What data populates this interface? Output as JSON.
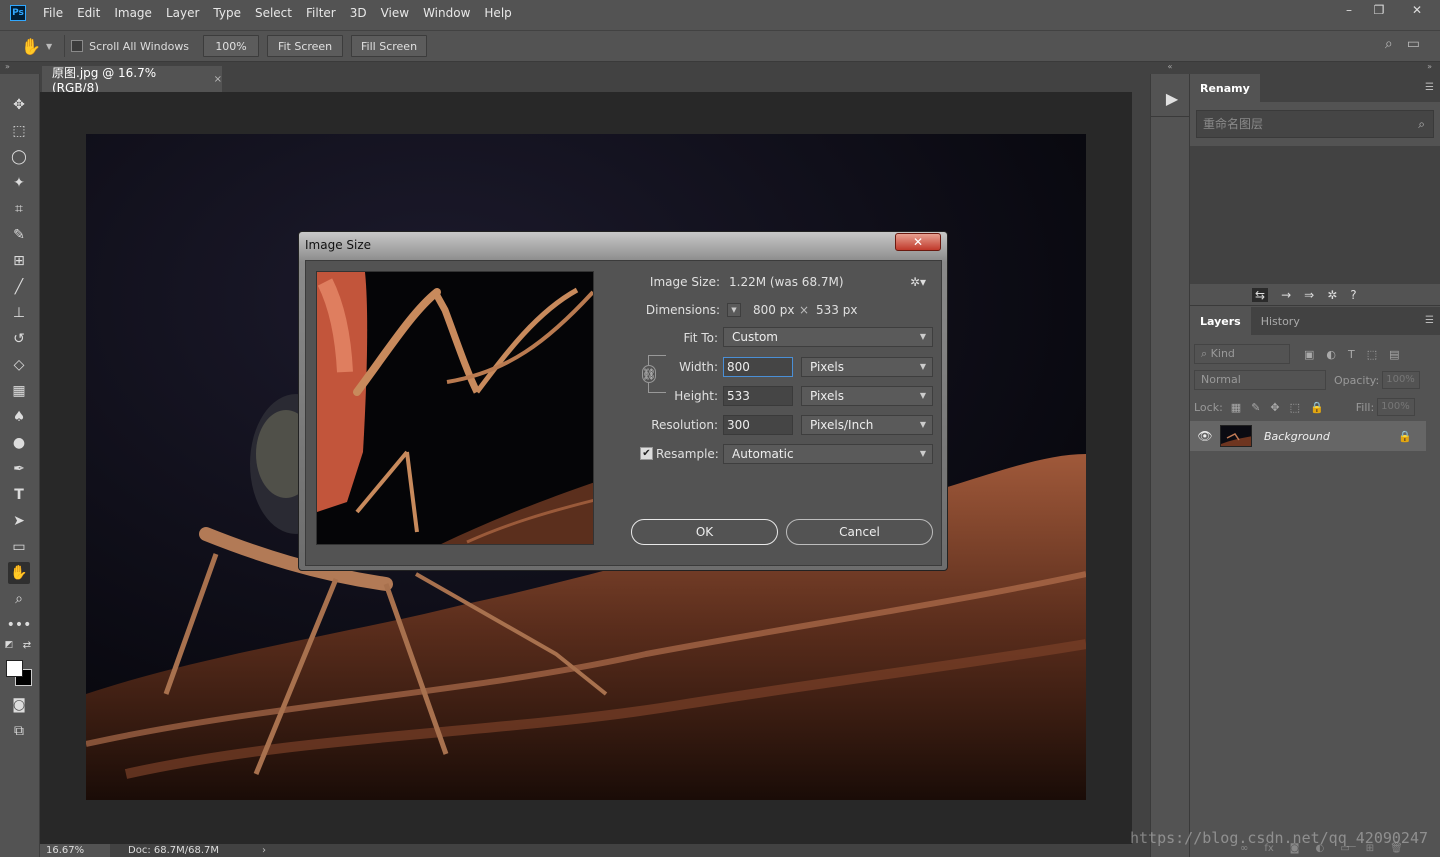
{
  "menubar": {
    "logo": "Ps",
    "items": [
      "File",
      "Edit",
      "Image",
      "Layer",
      "Type",
      "Select",
      "Filter",
      "3D",
      "View",
      "Window",
      "Help"
    ],
    "window_controls": {
      "minimize": "–",
      "restore": "❐",
      "close": "✕"
    }
  },
  "options_bar": {
    "scroll_all_windows": "Scroll All Windows",
    "zoom_100": "100%",
    "fit_screen": "Fit Screen",
    "fill_screen": "Fill Screen"
  },
  "document": {
    "tab_title": "原图.jpg @ 16.7% (RGB/8)",
    "tab_close": "×"
  },
  "statusbar": {
    "zoom": "16.67%",
    "doc_info": "Doc: 68.7M/68.7M",
    "arrow": "›"
  },
  "toolbar": {
    "tools": [
      "move-tool",
      "marquee-tool",
      "lasso-tool",
      "magic-wand-tool",
      "crop-tool",
      "eyedropper-tool",
      "healing-tool",
      "brush-tool",
      "stamp-tool",
      "history-brush-tool",
      "eraser-tool",
      "gradient-tool",
      "blur-tool",
      "dodge-tool",
      "pen-tool",
      "type-tool",
      "path-selection-tool",
      "rectangle-tool",
      "hand-tool",
      "zoom-tool",
      "more-tools"
    ],
    "active_tool": "hand-tool",
    "foreground_color": "#ffffff",
    "background_color": "#000000"
  },
  "renamy_panel": {
    "tab": "Renamy",
    "search_placeholder": "重命名图层"
  },
  "layers_panel": {
    "tabs": [
      "Layers",
      "History"
    ],
    "kind_label": "Kind",
    "blend_mode": "Normal",
    "opacity_label": "Opacity:",
    "opacity_value": "100%",
    "lock_label": "Lock:",
    "fill_label": "Fill:",
    "fill_value": "100%",
    "layers": [
      {
        "name": "Background",
        "visible": true,
        "locked": true
      }
    ]
  },
  "dialog": {
    "title": "Image Size",
    "close": "✕",
    "image_size_label": "Image Size:",
    "image_size_value": "1.22M (was 68.7M)",
    "dimensions_label": "Dimensions:",
    "dimensions_width": "800 px",
    "dimensions_x": "×",
    "dimensions_height": "533 px",
    "fit_to_label": "Fit To:",
    "fit_to_value": "Custom",
    "width_label": "Width:",
    "width_value": "800",
    "width_unit": "Pixels",
    "height_label": "Height:",
    "height_value": "533",
    "height_unit": "Pixels",
    "resolution_label": "Resolution:",
    "resolution_value": "300",
    "resolution_unit": "Pixels/Inch",
    "resample_label": "Resample:",
    "resample_checked": true,
    "resample_value": "Automatic",
    "ok": "OK",
    "cancel": "Cancel"
  },
  "watermark": "https://blog.csdn.net/qq_42090247"
}
